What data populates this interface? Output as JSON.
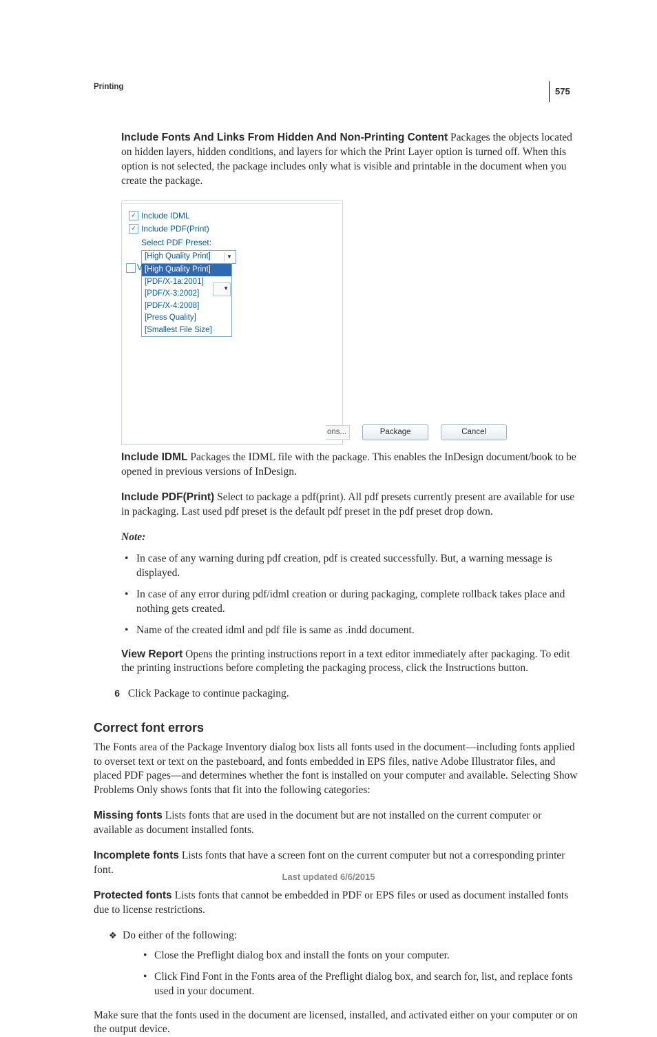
{
  "page": {
    "number": "575",
    "chapter": "Printing",
    "footer": "Last updated 6/6/2015"
  },
  "dialog": {
    "include_idml": "Include IDML",
    "include_pdf": "Include PDF(Print)",
    "select_preset_label": "Select PDF Preset:",
    "preset_selected": "[High Quality Print]",
    "presets": [
      "[High Quality Print]",
      "[PDF/X-1a:2001]",
      "[PDF/X-3:2002]",
      "[PDF/X-4:2008]",
      "[Press Quality]",
      "[Smallest File Size]"
    ],
    "vi_fragment": "Vi",
    "ons_fragment": "ons...",
    "btn_package": "Package",
    "btn_cancel": "Cancel"
  },
  "sections": {
    "include_fonts": {
      "title": "Include Fonts And Links From Hidden And Non-Printing Content",
      "body": "Packages the objects located on hidden layers, hidden conditions, and layers for which the Print Layer option is turned off. When this option is not selected, the package includes only what is visible and printable in the document when you create the package."
    },
    "include_idml": {
      "title": "Include IDML",
      "body": "Packages the IDML file with the package. This enables the InDesign document/book to be opened in previous versions of InDesign."
    },
    "include_pdf": {
      "title": "Include PDF(Print)",
      "body": "Select to package a pdf(print). All pdf presets currently present are available for use in packaging. Last used pdf preset is the default pdf preset in the pdf preset drop down."
    },
    "note_label": "Note:",
    "note_bullets": [
      "In case of any warning during pdf creation, pdf is created successfully. But, a warning message is displayed.",
      "In case of any error during pdf/idml creation or during packaging, complete rollback takes place and nothing gets created.",
      "Name of the created idml and pdf file is same as .indd document."
    ],
    "view_report": {
      "title": "View Report",
      "body": "Opens the printing instructions report in a text editor immediately after packaging. To edit the printing instructions before completing the packaging process, click the Instructions button."
    },
    "step6": {
      "num": "6",
      "text": "Click Package to continue packaging."
    },
    "correct_fonts": {
      "heading": "Correct font errors",
      "intro": "The Fonts area of the Package Inventory dialog box lists all fonts used in the document—including fonts applied to overset text or text on the pasteboard, and fonts embedded in EPS files, native Adobe Illustrator files, and placed PDF pages—and determines whether the font is installed on your computer and available. Selecting Show Problems Only shows fonts that fit into the following categories:",
      "missing": {
        "title": "Missing fonts",
        "body": "Lists fonts that are used in the document but are not installed on the current computer or available as document installed fonts."
      },
      "incomplete": {
        "title": "Incomplete fonts",
        "body": "Lists fonts that have a screen font on the current computer but not a corresponding printer font."
      },
      "protected": {
        "title": "Protected fonts",
        "body": "Lists fonts that cannot be embedded in PDF or EPS files or used as document installed fonts due to license restrictions."
      },
      "do_either": "Do either of the following:",
      "sub": [
        "Close the Preflight dialog box and install the fonts on your computer.",
        "Click Find Font in the Fonts area of the Preflight dialog box, and search for, list, and replace fonts used in your document."
      ],
      "make_sure": "Make sure that the fonts used in the document are licensed, installed, and activated either on your computer or on the output device."
    }
  }
}
